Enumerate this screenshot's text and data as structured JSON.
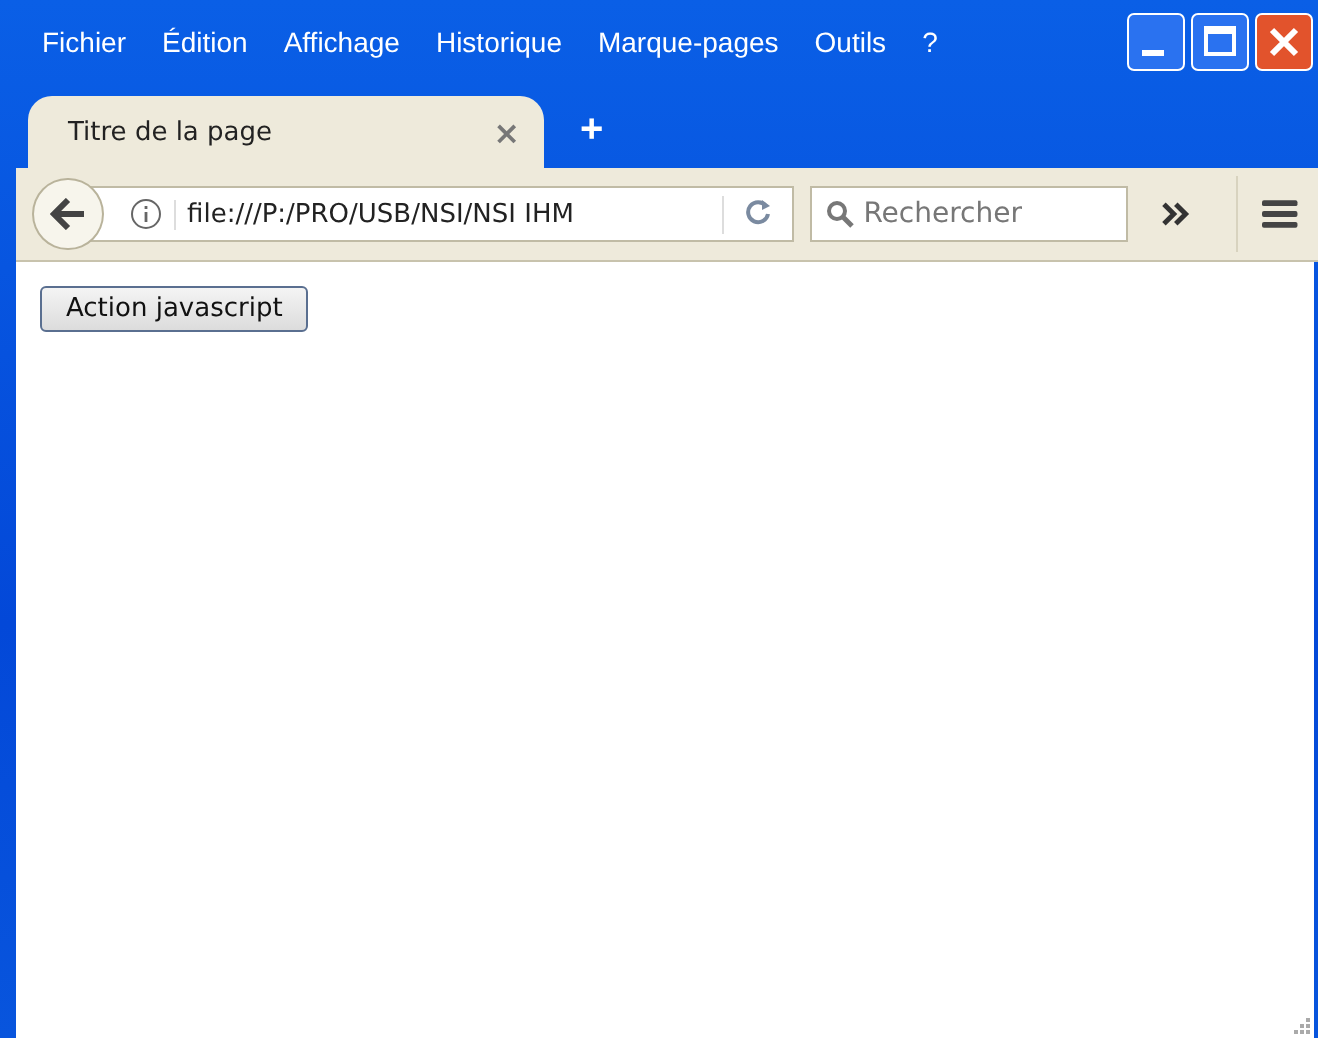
{
  "menu": [
    {
      "label": "Fichier"
    },
    {
      "label": "Édition"
    },
    {
      "label": "Affichage"
    },
    {
      "label": "Historique"
    },
    {
      "label": "Marque-pages"
    },
    {
      "label": "Outils"
    },
    {
      "label": "?"
    }
  ],
  "tabs": [
    {
      "label": "Titre de la page",
      "close": "×",
      "selected": true
    }
  ],
  "new_tab": "+",
  "address": {
    "value": "file:///P:/PRO/USB/NSI/NSI IHM"
  },
  "search": {
    "placeholder": "Rechercher"
  },
  "page": {
    "button": "Action javascript"
  }
}
